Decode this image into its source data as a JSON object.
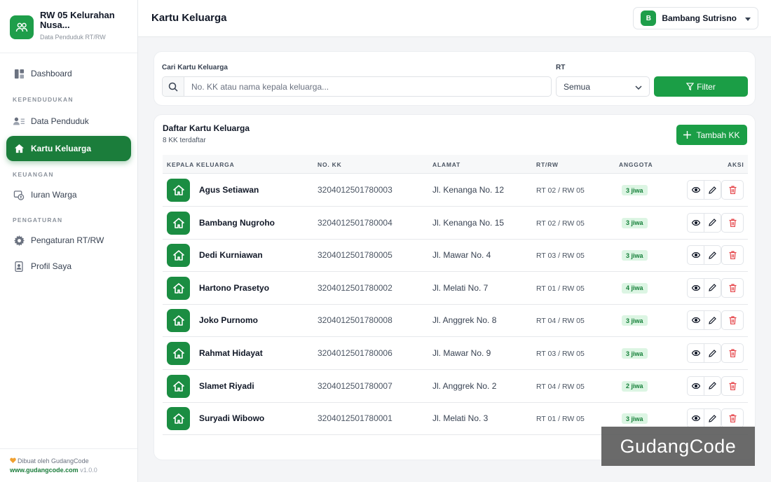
{
  "brand": {
    "title_line1": "RW 05 Kelurahan",
    "title_line2": "Nusa...",
    "subtitle": "Data Penduduk RT/RW"
  },
  "nav": {
    "dashboard": "Dashboard",
    "section_kependudukan": "KEPENDUDUKAN",
    "data_penduduk": "Data Penduduk",
    "kartu_keluarga": "Kartu Keluarga",
    "section_keuangan": "KEUANGAN",
    "iuran_warga": "Iuran Warga",
    "section_pengaturan": "PENGATURAN",
    "pengaturan_rtrw": "Pengaturan RT/RW",
    "profil_saya": "Profil Saya"
  },
  "footer": {
    "made_by": "Dibuat oleh GudangCode",
    "site": "www.gudangcode.com",
    "version": "v1.0.0"
  },
  "header": {
    "title": "Kartu Keluarga",
    "user_initial": "B",
    "user_name": "Bambang Sutrisno"
  },
  "filter": {
    "search_label": "Cari Kartu Keluarga",
    "search_placeholder": "No. KK atau nama kepala keluarga...",
    "search_value": "",
    "rt_label": "RT",
    "rt_selected": "Semua",
    "filter_button": "Filter"
  },
  "list": {
    "title": "Daftar Kartu Keluarga",
    "count_text": "8 KK terdaftar",
    "add_button": "Tambah KK",
    "columns": {
      "kepala": "KEPALA KELUARGA",
      "nokk": "NO. KK",
      "alamat": "ALAMAT",
      "rtrw": "RT/RW",
      "anggota": "ANGGOTA",
      "aksi": "AKSI"
    },
    "rows": [
      {
        "name": "Agus Setiawan",
        "nokk": "3204012501780003",
        "alamat": "Jl. Kenanga No. 12",
        "rtrw": "RT 02 / RW 05",
        "anggota": "3 jiwa"
      },
      {
        "name": "Bambang Nugroho",
        "nokk": "3204012501780004",
        "alamat": "Jl. Kenanga No. 15",
        "rtrw": "RT 02 / RW 05",
        "anggota": "3 jiwa"
      },
      {
        "name": "Dedi Kurniawan",
        "nokk": "3204012501780005",
        "alamat": "Jl. Mawar No. 4",
        "rtrw": "RT 03 / RW 05",
        "anggota": "3 jiwa"
      },
      {
        "name": "Hartono Prasetyo",
        "nokk": "3204012501780002",
        "alamat": "Jl. Melati No. 7",
        "rtrw": "RT 01 / RW 05",
        "anggota": "4 jiwa"
      },
      {
        "name": "Joko Purnomo",
        "nokk": "3204012501780008",
        "alamat": "Jl. Anggrek No. 8",
        "rtrw": "RT 04 / RW 05",
        "anggota": "3 jiwa"
      },
      {
        "name": "Rahmat Hidayat",
        "nokk": "3204012501780006",
        "alamat": "Jl. Mawar No. 9",
        "rtrw": "RT 03 / RW 05",
        "anggota": "3 jiwa"
      },
      {
        "name": "Slamet Riyadi",
        "nokk": "3204012501780007",
        "alamat": "Jl. Anggrek No. 2",
        "rtrw": "RT 04 / RW 05",
        "anggota": "2 jiwa"
      },
      {
        "name": "Suryadi Wibowo",
        "nokk": "3204012501780001",
        "alamat": "Jl. Melati No. 3",
        "rtrw": "RT 01 / RW 05",
        "anggota": "3 jiwa"
      }
    ]
  },
  "watermark": "GudangCode",
  "icons": {
    "brand": "people-icon",
    "dashboard": "grid-icon",
    "data_penduduk": "user-list-icon",
    "kartu_keluarga": "home-icon",
    "iuran": "money-icon",
    "settings": "gear-icon",
    "profile": "id-card-icon",
    "view": "eye-icon",
    "edit": "pencil-icon",
    "delete": "trash-icon"
  },
  "colors": {
    "primary": "#1b9e46",
    "active_nav": "#1b7d3b",
    "badge_bg": "#dcf5e3",
    "badge_text": "#16803a",
    "delete": "#e5484d"
  }
}
